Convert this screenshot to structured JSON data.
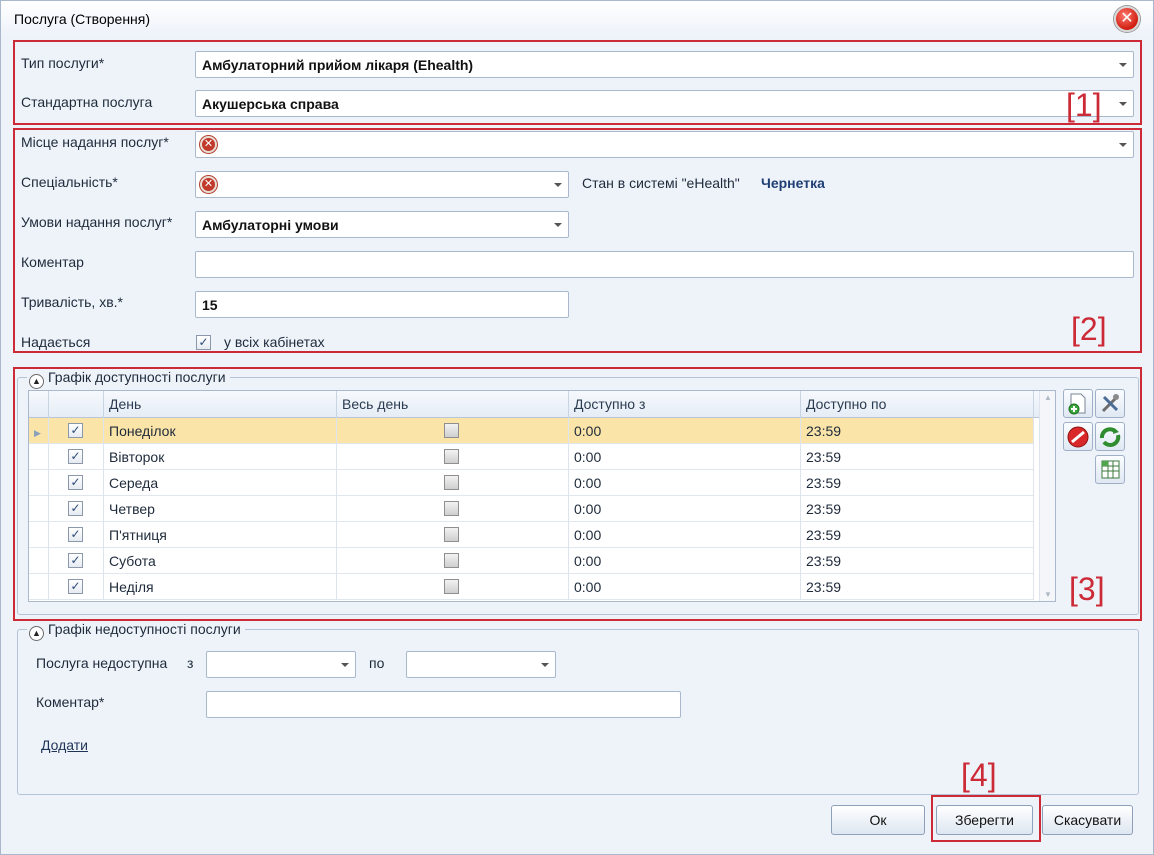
{
  "window": {
    "title": "Послуга (Створення)"
  },
  "section1": {
    "service_type_label": "Тип послуги*",
    "service_type_value": "Амбулаторний прийом лікаря (Ehealth)",
    "standard_service_label": "Стандартна послуга",
    "standard_service_value": "Акушерська справа",
    "marker": "[1]"
  },
  "section2": {
    "place_label": "Місце надання послуг*",
    "specialty_label": "Спеціальність*",
    "ehealth_state_label": "Стан в системі \"eHealth\"",
    "ehealth_state_value": "Чернетка",
    "conditions_label": "Умови надання послуг*",
    "conditions_value": "Амбулаторні умови",
    "comment_label": "Коментар",
    "comment_value": "",
    "duration_label": "Тривалість, хв.*",
    "duration_value": "15",
    "provided_label": "Надається",
    "all_cabinets_label": "у всіх кабінетах",
    "marker": "[2]"
  },
  "availability": {
    "title": "Графік доступності послуги",
    "columns": [
      "День",
      "Весь день",
      "Доступно з",
      "Доступно по"
    ],
    "rows": [
      {
        "day": "Понеділок",
        "from": "0:00",
        "to": "23:59"
      },
      {
        "day": "Вівторок",
        "from": "0:00",
        "to": "23:59"
      },
      {
        "day": "Середа",
        "from": "0:00",
        "to": "23:59"
      },
      {
        "day": "Четвер",
        "from": "0:00",
        "to": "23:59"
      },
      {
        "day": "П'ятниця",
        "from": "0:00",
        "to": "23:59"
      },
      {
        "day": "Субота",
        "from": "0:00",
        "to": "23:59"
      },
      {
        "day": "Неділя",
        "from": "0:00",
        "to": "23:59"
      }
    ],
    "marker": "[3]"
  },
  "unavailability": {
    "title": "Графік недоступності послуги",
    "unavailable_label": "Послуга недоступна",
    "from_label": "з",
    "to_label": "по",
    "comment_label": "Коментар*",
    "add_link": "Додати"
  },
  "footer": {
    "ok_label": "Ок",
    "save_label": "Зберегти",
    "cancel_label": "Скасувати",
    "marker": "[4]"
  },
  "colors": {
    "annotation_red": "#cc2a36",
    "selected_row": "#fbe4a8",
    "dialog_bg": "#eef3fa"
  }
}
